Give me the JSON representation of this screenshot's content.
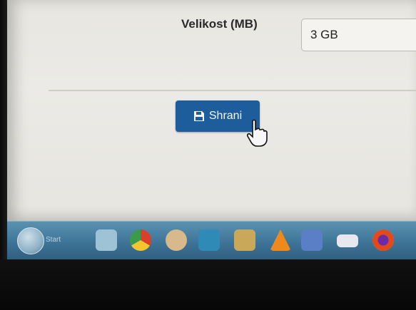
{
  "form": {
    "size_label": "Velikost (MB)",
    "size_value": "3 GB",
    "save_label": "Shrani"
  },
  "taskbar": {
    "start_label": "Start",
    "icons": [
      "folder-icon",
      "chrome-icon",
      "app-icon",
      "kodi-icon",
      "tools-icon",
      "vlc-icon",
      "settings-icon",
      "camera-icon",
      "browser-icon"
    ]
  },
  "colors": {
    "button": "#1d5d9c",
    "page_background": "#e8e7e2",
    "taskbar": "#3e7497"
  }
}
